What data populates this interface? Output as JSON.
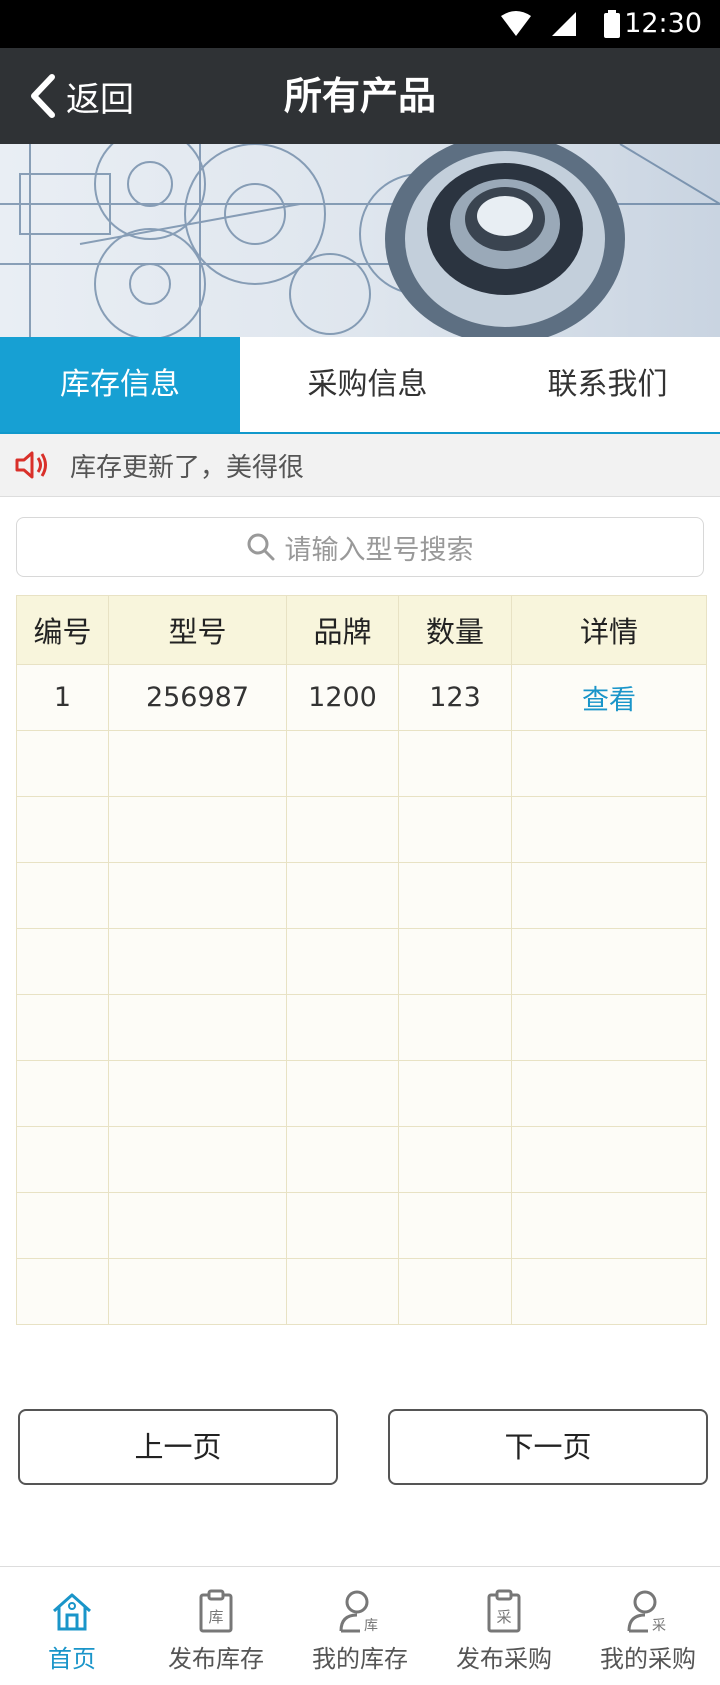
{
  "status_bar": {
    "time": "12:30"
  },
  "header": {
    "back_label": "返回",
    "title": "所有产品"
  },
  "tabs": [
    {
      "label": "库存信息",
      "active": true
    },
    {
      "label": "采购信息",
      "active": false
    },
    {
      "label": "联系我们",
      "active": false
    }
  ],
  "notice": {
    "text": "库存更新了，美得很"
  },
  "search": {
    "placeholder": "请输入型号搜索"
  },
  "table": {
    "headers": [
      "编号",
      "型号",
      "品牌",
      "数量",
      "详情"
    ],
    "rows": [
      [
        "1",
        "256987",
        "1200",
        "123",
        "查看"
      ]
    ]
  },
  "pager": {
    "prev": "上一页",
    "next": "下一页"
  },
  "bottom_nav": [
    {
      "label": "首页",
      "icon": "home-icon",
      "active": true
    },
    {
      "label": "发布库存",
      "icon": "clipboard-ku-icon",
      "active": false,
      "glyph": "库"
    },
    {
      "label": "我的库存",
      "icon": "user-ku-icon",
      "active": false,
      "glyph": "库"
    },
    {
      "label": "发布采购",
      "icon": "clipboard-cai-icon",
      "active": false,
      "glyph": "采"
    },
    {
      "label": "我的采购",
      "icon": "user-cai-icon",
      "active": false,
      "glyph": "采"
    }
  ],
  "colors": {
    "accent": "#17a0d3",
    "header_bg": "#2f3235",
    "table_header_bg": "#f8f5dc"
  }
}
